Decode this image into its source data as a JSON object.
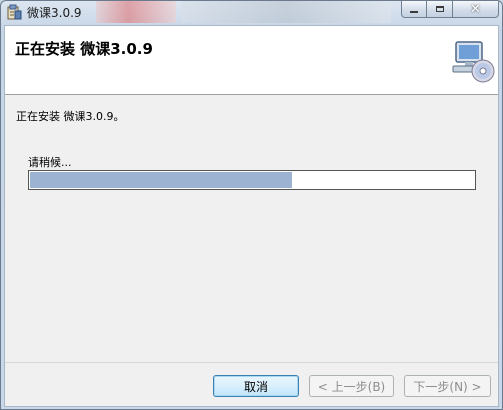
{
  "window": {
    "title": "微课3.0.9",
    "controls": {
      "minimize_icon": "minimize-icon",
      "maximize_icon": "maximize-icon",
      "close_glyph": "✕"
    }
  },
  "banner": {
    "title": "正在安装 微课3.0.9",
    "icon": "computer-cd-icon"
  },
  "main": {
    "status_text": "正在安装 微课3.0.9。",
    "wait_text": "请稍候...",
    "progress_fraction": 0.59
  },
  "footer": {
    "cancel_label": "取消",
    "back_label": "< 上一步(B)",
    "next_label": "下一步(N) >"
  },
  "colors": {
    "progress_fill": "#9db3d2",
    "accent_button_border": "#3c7fb1"
  }
}
